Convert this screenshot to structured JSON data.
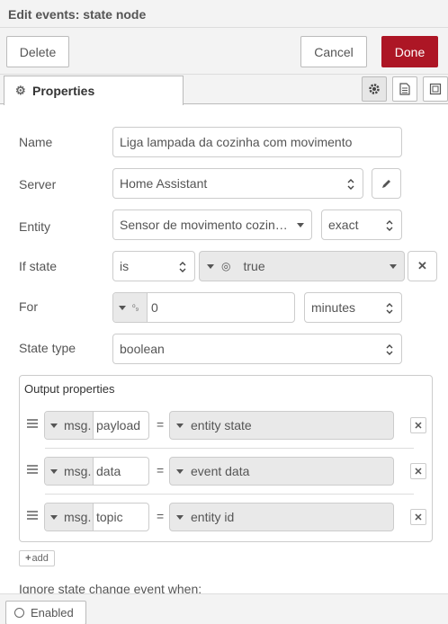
{
  "header": {
    "title": "Edit events: state node"
  },
  "toolbar": {
    "delete_label": "Delete",
    "cancel_label": "Cancel",
    "done_label": "Done"
  },
  "tabs": {
    "properties_label": "Properties"
  },
  "form": {
    "name_label": "Name",
    "name_value": "Liga lampada da cozinha  com movimento",
    "server_label": "Server",
    "server_value": "Home Assistant",
    "entity_label": "Entity",
    "entity_value": "Sensor de movimento cozin…",
    "entity_match": "exact",
    "ifstate_label": "If state",
    "ifstate_op": "is",
    "ifstate_value": "true",
    "for_label": "For",
    "for_value": "0",
    "for_unit": "minutes",
    "statetype_label": "State type",
    "statetype_value": "boolean"
  },
  "output": {
    "title": "Output properties",
    "rows": [
      {
        "prefix": "msg.",
        "property": "payload",
        "value": "entity state"
      },
      {
        "prefix": "msg.",
        "property": "data",
        "value": "event data"
      },
      {
        "prefix": "msg.",
        "property": "topic",
        "value": "entity id"
      }
    ],
    "add_label": "add"
  },
  "ignore_label": "Ignore state change event when:",
  "footer": {
    "enabled_label": "Enabled"
  },
  "colors": {
    "primary": "#ad1625",
    "panel": "#f3f3f3"
  }
}
